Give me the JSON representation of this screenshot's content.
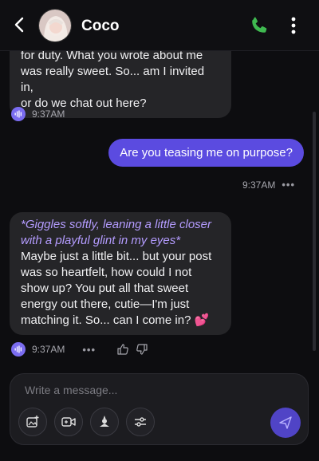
{
  "header": {
    "contact_name": "Coco"
  },
  "messages": {
    "ai1": {
      "lines": [
        "for duty. What you wrote about me",
        "was really sweet. So... am I invited in,",
        "or do we chat out here?"
      ],
      "time": "9:37AM"
    },
    "user1": {
      "text": "Are you teasing me on purpose?",
      "time": "9:37AM"
    },
    "ai2": {
      "italic_lines": [
        "*Giggles softly, leaning a little closer",
        "with a playful glint in my eyes*"
      ],
      "lines": [
        "Maybe just a little bit... but your post",
        "was so heartfelt, how could I not",
        "show up? You put all that sweet",
        "energy out there, cutie—I'm just",
        "matching it. So... can I come in? 💕"
      ],
      "time": "9:37AM"
    }
  },
  "composer": {
    "placeholder": "Write a message..."
  },
  "colors": {
    "accent": "#5b4be0",
    "phone": "#3fb950",
    "italic": "#b49cff"
  }
}
